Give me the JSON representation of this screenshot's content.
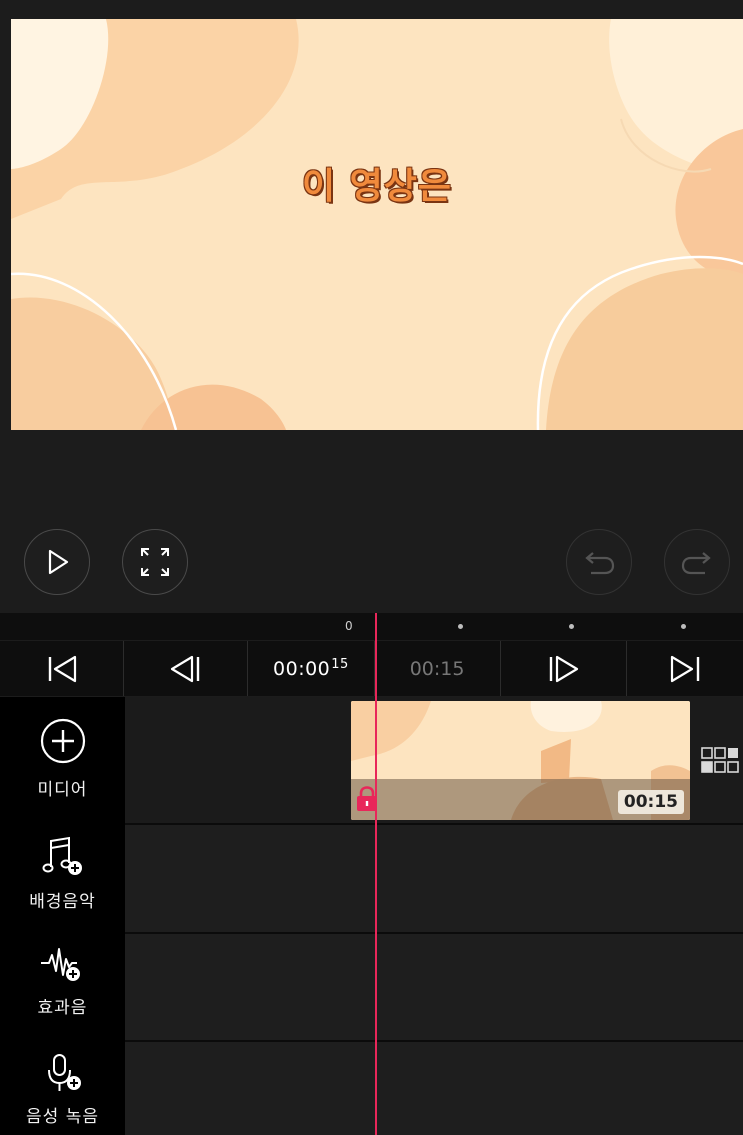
{
  "preview": {
    "title": "이 영상은"
  },
  "controls": {
    "play": "play-icon",
    "fullscreen": "fullscreen-icon",
    "undo": "undo-icon",
    "redo": "redo-icon"
  },
  "ruler": {
    "zero_label": "0"
  },
  "transport": {
    "current_time": "00:00",
    "current_frames": "15",
    "total_time": "00:15"
  },
  "sidebar": {
    "items": [
      {
        "label": "미디어",
        "icon": "add-circle-icon"
      },
      {
        "label": "배경음악",
        "icon": "music-note-add-icon"
      },
      {
        "label": "효과음",
        "icon": "waveform-add-icon"
      },
      {
        "label": "음성 녹음",
        "icon": "microphone-add-icon"
      }
    ]
  },
  "clip": {
    "duration": "00:15"
  },
  "colors": {
    "playhead": "#e8275a",
    "lock": "#e8275a",
    "preview_bg": "#fde4c0",
    "title_fill": "#f08a3c",
    "title_outline": "#7a3412"
  }
}
